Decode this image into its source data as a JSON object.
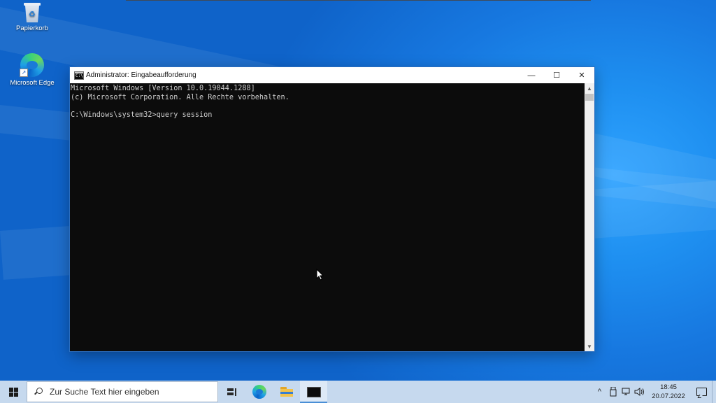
{
  "desktop": {
    "icons": [
      {
        "label": "Papierkorb",
        "icon": "recycle-bin-icon"
      },
      {
        "label": "Microsoft Edge",
        "icon": "edge-icon"
      }
    ]
  },
  "window": {
    "title": "Administrator: Eingabeaufforderung",
    "icon_text": "C:\\",
    "controls": {
      "minimize": "—",
      "maximize": "☐",
      "close": "✕"
    },
    "console_lines": [
      "Microsoft Windows [Version 10.0.19044.1288]",
      "(c) Microsoft Corporation. Alle Rechte vorbehalten.",
      "",
      "C:\\Windows\\system32>query session"
    ]
  },
  "taskbar": {
    "search_placeholder": "Zur Suche Text hier eingeben",
    "pinned": [
      "task-view-icon",
      "edge-icon",
      "file-explorer-icon",
      "command-prompt-icon"
    ],
    "active_app": "command-prompt",
    "tray": {
      "chevron": "^",
      "clock_time": "18:45",
      "clock_date": "20.07.2022"
    }
  },
  "colors": {
    "console_bg": "#0c0c0c",
    "console_text": "#cccccc",
    "taskbar_bg": "#c6d9ee",
    "desktop_blue": "#1778e0"
  }
}
